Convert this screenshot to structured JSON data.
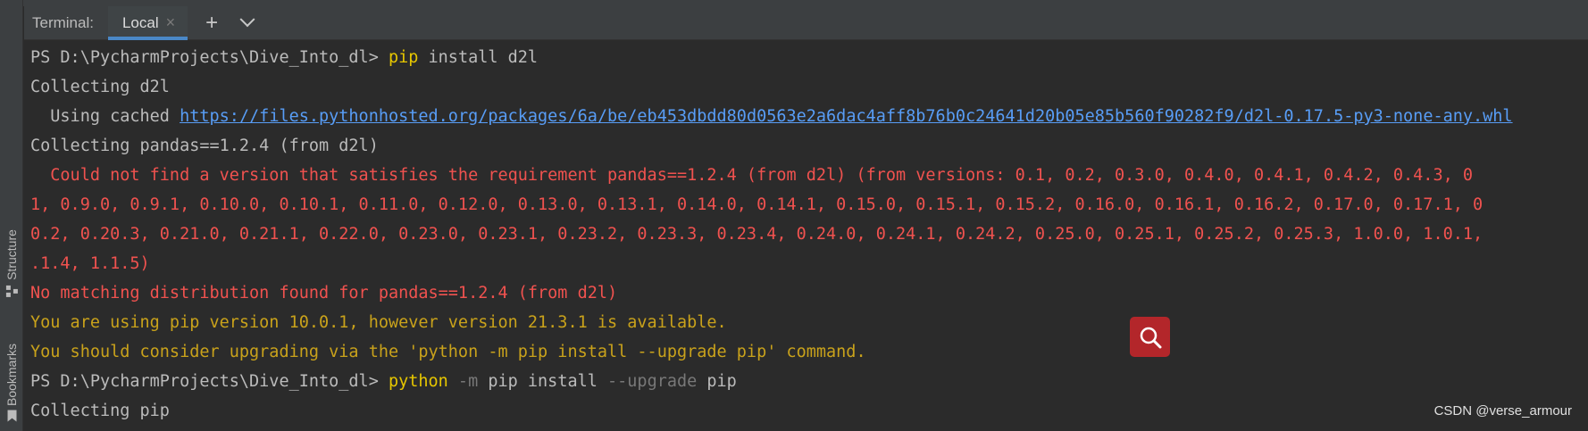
{
  "tool_strip": {
    "structure_label": "Structure",
    "bookmarks_label": "Bookmarks"
  },
  "tabbar": {
    "title": "Terminal:",
    "tabs": [
      {
        "label": "Local",
        "active": true
      }
    ],
    "close_glyph": "×",
    "add_glyph": "+"
  },
  "terminal": {
    "l1": {
      "prompt": "PS D:\\PycharmProjects\\Dive_Into_dl> ",
      "cmd": "pip",
      "rest": " install d2l"
    },
    "l2": "Collecting d2l",
    "l3": {
      "prefix": "  Using cached ",
      "url": "https://files.pythonhosted.org/packages/6a/be/eb453dbdd80d0563e2a6dac4aff8b76b0c24641d20b05e85b560f90282f9/d2l-0.17.5-py3-none-any.whl"
    },
    "l4": "Collecting pandas==1.2.4 (from d2l)",
    "l5": "  Could not find a version that satisfies the requirement pandas==1.2.4 (from d2l) (from versions: 0.1, 0.2, 0.3.0, 0.4.0, 0.4.1, 0.4.2, 0.4.3, 0",
    "l6": "1, 0.9.0, 0.9.1, 0.10.0, 0.10.1, 0.11.0, 0.12.0, 0.13.0, 0.13.1, 0.14.0, 0.14.1, 0.15.0, 0.15.1, 0.15.2, 0.16.0, 0.16.1, 0.16.2, 0.17.0, 0.17.1, 0",
    "l7": "0.2, 0.20.3, 0.21.0, 0.21.1, 0.22.0, 0.23.0, 0.23.1, 0.23.2, 0.23.3, 0.23.4, 0.24.0, 0.24.1, 0.24.2, 0.25.0, 0.25.1, 0.25.2, 0.25.3, 1.0.0, 1.0.1,",
    "l8": ".1.4, 1.1.5)",
    "l9": "No matching distribution found for pandas==1.2.4 (from d2l)",
    "l10": "You are using pip version 10.0.1, however version 21.3.1 is available.",
    "l11": "You should consider upgrading via the 'python -m pip install --upgrade pip' command.",
    "l12": {
      "prompt": "PS D:\\PycharmProjects\\Dive_Into_dl> ",
      "cmd": "python",
      "flag1": " -m",
      "mid": " pip install",
      "flag2": " --upgrade",
      "end": " pip"
    },
    "l13": "Collecting pip"
  },
  "watermark": "CSDN @verse_armour",
  "colors": {
    "background": "#2b2b2b",
    "panel": "#3c3f41",
    "accent": "#4a88c7",
    "error": "#f0524f",
    "warning": "#c9a21b",
    "command": "#e6c600",
    "link": "#589df6",
    "search_badge": "#b3262a"
  }
}
